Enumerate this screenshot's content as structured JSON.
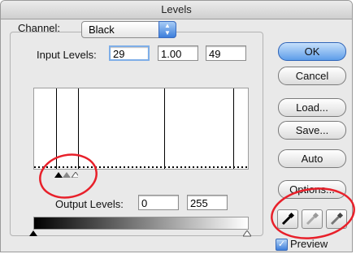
{
  "window": {
    "title": "Levels"
  },
  "channel": {
    "label": "Channel:",
    "value": "Black"
  },
  "input_levels": {
    "label": "Input Levels:",
    "black": "29",
    "gamma": "1.00",
    "white": "49"
  },
  "output_levels": {
    "label": "Output Levels:",
    "black": "0",
    "white": "255"
  },
  "buttons": {
    "ok": "OK",
    "cancel": "Cancel",
    "load": "Load...",
    "save": "Save...",
    "auto": "Auto",
    "options": "Options..."
  },
  "preview": {
    "label": "Preview",
    "checked": true
  },
  "icons": {
    "black_eyedropper": "black-eyedropper-icon",
    "gray_eyedropper": "gray-eyedropper-icon",
    "white_eyedropper": "white-eyedropper-icon"
  },
  "colors": {
    "annotation": "#e8202a",
    "default_button": "#5d9de9"
  }
}
